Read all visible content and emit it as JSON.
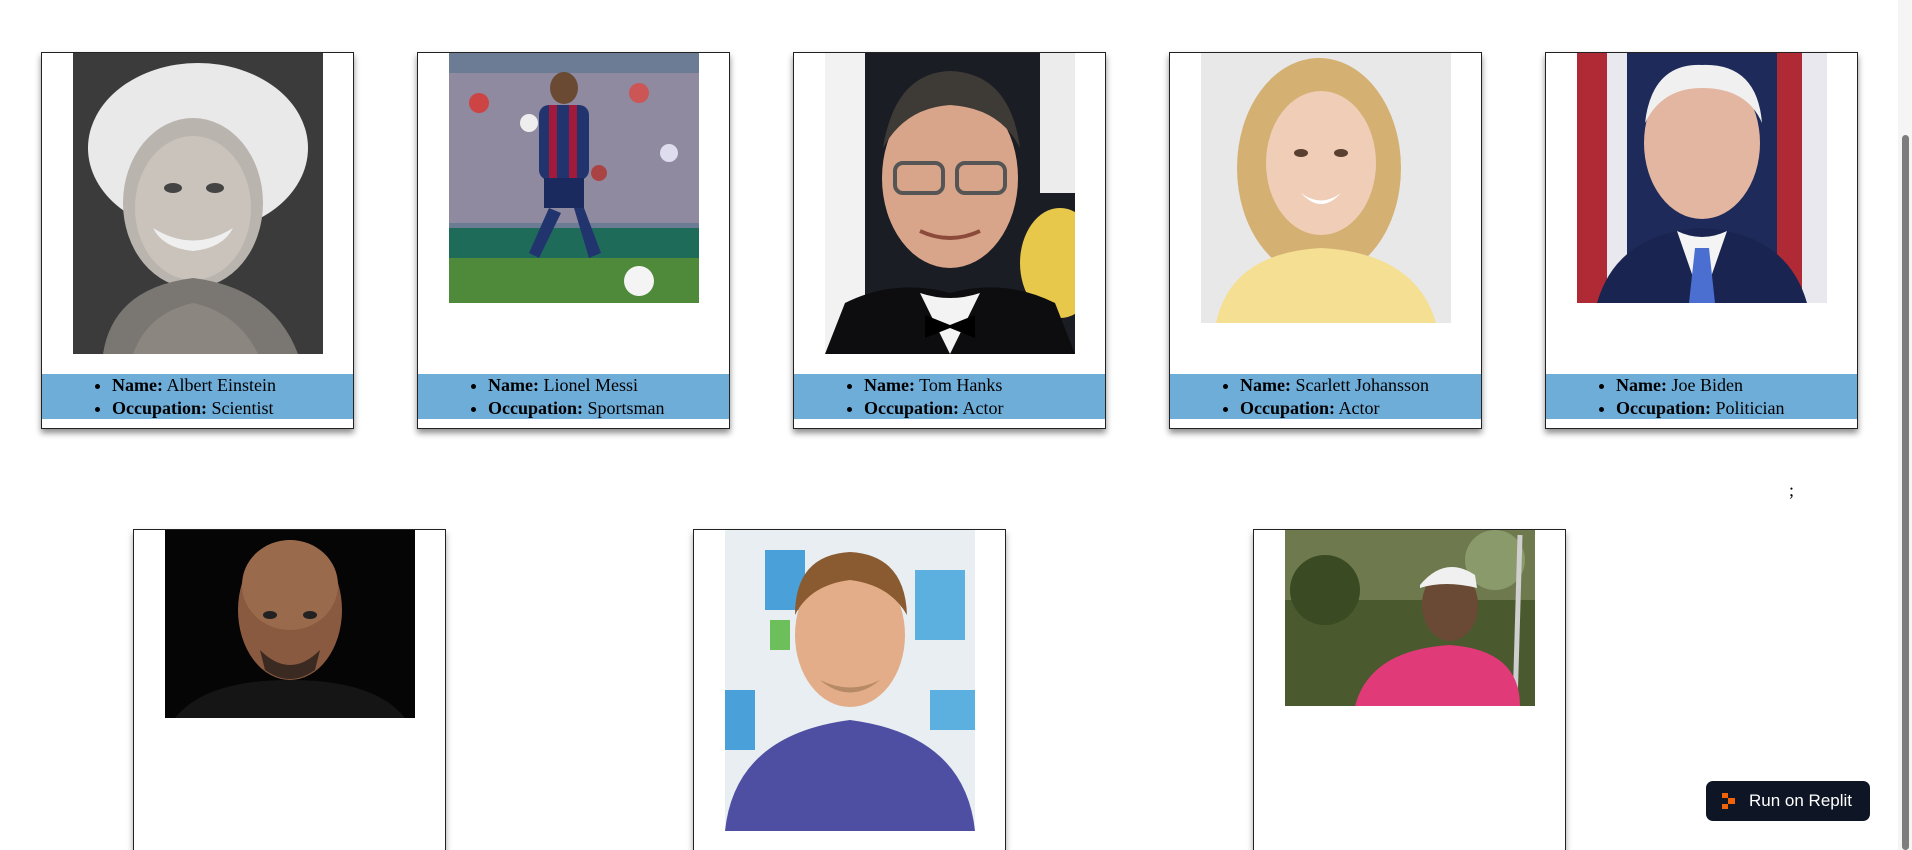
{
  "cards_row1": [
    {
      "name_label": "Name:",
      "name": "Albert Einstein",
      "occupation_label": "Occupation:",
      "occupation": "Scientist",
      "photo": "albert-einstein-portrait"
    },
    {
      "name_label": "Name:",
      "name": "Lionel Messi",
      "occupation_label": "Occupation:",
      "occupation": "Sportsman",
      "photo": "lionel-messi-photo"
    },
    {
      "name_label": "Name:",
      "name": "Tom Hanks",
      "occupation_label": "Occupation:",
      "occupation": "Actor",
      "photo": "tom-hanks-photo"
    },
    {
      "name_label": "Name:",
      "name": "Scarlett Johansson",
      "occupation_label": "Occupation:",
      "occupation": "Actor",
      "photo": "scarlett-johansson-photo"
    },
    {
      "name_label": "Name:",
      "name": "Joe Biden",
      "occupation_label": "Occupation:",
      "occupation": "Politician",
      "photo": "joe-biden-photo"
    }
  ],
  "cards_row2": [
    {
      "photo": "dwayne-johnson-photo"
    },
    {
      "photo": "chris-martin-photo"
    },
    {
      "photo": "tiger-woods-photo"
    }
  ],
  "stray_text": ";",
  "replit": {
    "label": "Run on Replit",
    "icon": "replit-logo-icon"
  },
  "colors": {
    "info_band": "#6fadd9",
    "replit_bg": "#0e1525",
    "replit_logo": "#f26207"
  }
}
